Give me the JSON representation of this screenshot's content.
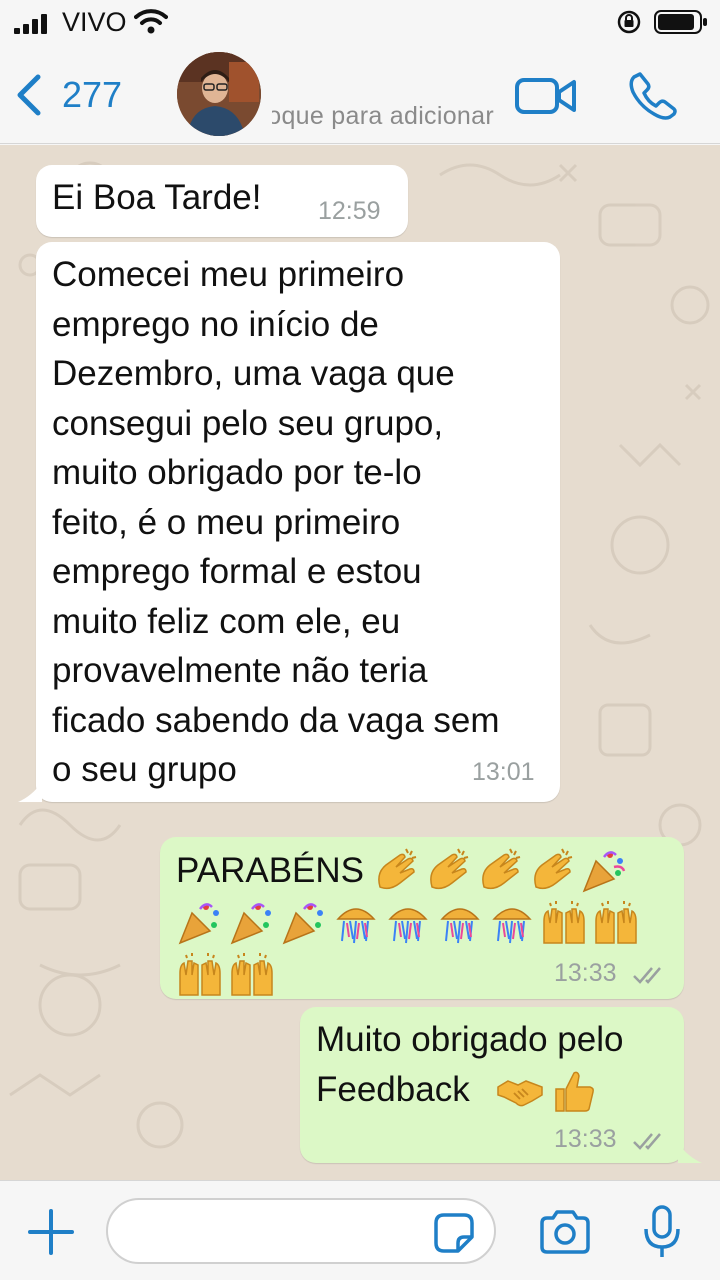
{
  "status_bar": {
    "carrier": "VIVO"
  },
  "header": {
    "back_count": "277",
    "subtitle": "toque para adicionar a",
    "accent_color": "#1f7fc7"
  },
  "messages": [
    {
      "direction": "incoming",
      "text": "Ei Boa Tarde!",
      "time": "12:59"
    },
    {
      "direction": "incoming",
      "text": "Comecei meu primeiro\nemprego no início de\nDezembro, uma vaga que\nconsegui pelo seu grupo,\nmuito obrigado por te-lo\nfeito, é o meu primeiro\nemprego formal e estou\nmuito feliz com ele, eu\nprovavelmente não teria\nficado sabendo da vaga sem\no seu grupo",
      "time": "13:01"
    },
    {
      "direction": "outgoing",
      "text": "PARABÉNS",
      "emoji_lines": [
        [
          "clapping-hands",
          "clapping-hands",
          "clapping-hands",
          "clapping-hands",
          "party-popper"
        ],
        [
          "party-popper",
          "party-popper",
          "party-popper",
          "confetti-ball",
          "confetti-ball",
          "confetti-ball",
          "confetti-ball",
          "raising-hands",
          "raising-hands"
        ],
        [
          "raising-hands",
          "raising-hands"
        ]
      ],
      "time": "13:33",
      "status": "read"
    },
    {
      "direction": "outgoing",
      "text": "Muito obrigado pelo\nFeedback",
      "emoji_lines": [
        [
          "handshake",
          "thumbs-up"
        ]
      ],
      "time": "13:33",
      "status": "read"
    }
  ],
  "input": {
    "placeholder": "",
    "value": ""
  },
  "colors": {
    "incoming_bubble": "#ffffff",
    "outgoing_bubble": "#dcf8c6",
    "wallpaper": "#e6dccf",
    "bar_background": "#f6f6f6"
  }
}
